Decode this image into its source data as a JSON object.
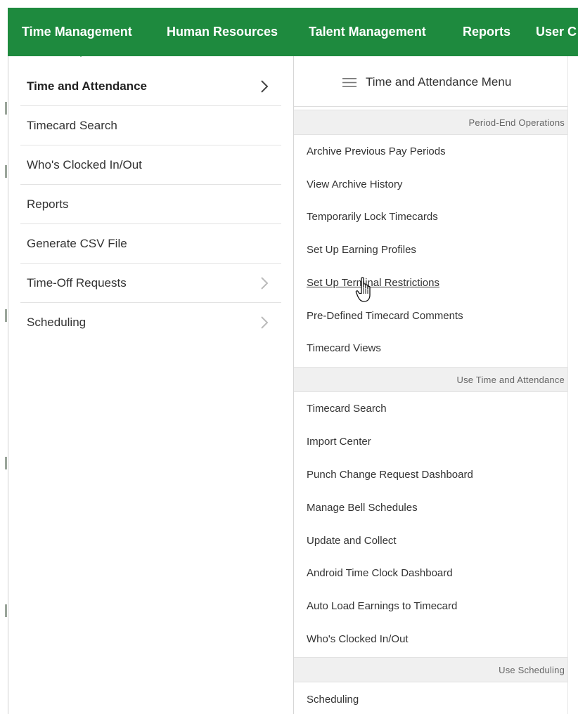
{
  "nav": {
    "items": [
      "Time Management",
      "Human Resources",
      "Talent Management",
      "Reports",
      "User C"
    ]
  },
  "left_menu": {
    "items": [
      {
        "label": "Time and Attendance",
        "active": true,
        "has_arrow": true
      },
      {
        "label": "Timecard Search",
        "active": false,
        "has_arrow": false
      },
      {
        "label": "Who's Clocked In/Out",
        "active": false,
        "has_arrow": false
      },
      {
        "label": "Reports",
        "active": false,
        "has_arrow": false
      },
      {
        "label": "Generate CSV File",
        "active": false,
        "has_arrow": false
      },
      {
        "label": "Time-Off Requests",
        "active": false,
        "has_arrow": true
      },
      {
        "label": "Scheduling",
        "active": false,
        "has_arrow": true
      }
    ]
  },
  "right_menu": {
    "title": "Time and Attendance Menu",
    "icon": "hamburger-icon",
    "sections": [
      {
        "heading": "Period-End Operations",
        "items": [
          "Archive Previous Pay Periods",
          "View Archive History",
          "Temporarily Lock Timecards",
          "Set Up Earning Profiles",
          "Set Up Terminal Restrictions",
          "Pre-Defined Timecard Comments",
          "Timecard Views"
        ]
      },
      {
        "heading": "Use Time and Attendance",
        "items": [
          "Timecard Search",
          "Import Center",
          "Punch Change Request Dashboard",
          "Manage Bell Schedules",
          "Update and Collect",
          "Android Time Clock Dashboard",
          "Auto Load Earnings to Timecard",
          "Who's Clocked In/Out"
        ]
      },
      {
        "heading": "Use Scheduling",
        "items": [
          "Scheduling"
        ]
      }
    ],
    "hovered_item": "Set Up Terminal Restrictions"
  },
  "colors": {
    "nav_bg": "#1e8a3e",
    "section_bg": "#f0f0f0"
  }
}
